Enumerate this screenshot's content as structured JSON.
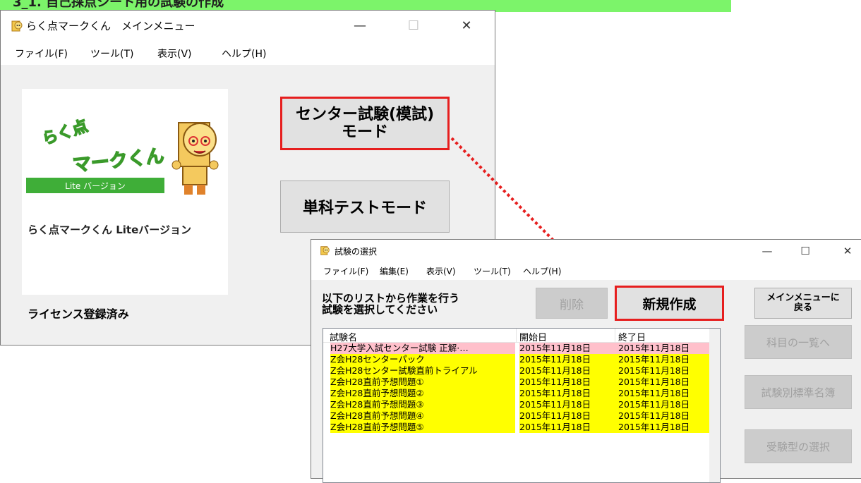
{
  "banner": {
    "text": "3_1. 自己採点シート用の試験の作成"
  },
  "main_window": {
    "title": "らく点マークくん　メインメニュー",
    "menu": [
      "ファイル(F)",
      "ツール(T)",
      "表示(V)",
      "ヘルプ(H)"
    ],
    "logo": {
      "line1": "らく点",
      "line2": "マークくん",
      "badge": "Lite バージョン"
    },
    "logo_caption": "らく点マークくん Liteバージョン",
    "license": "ライセンス登録済み",
    "center_mode_line1": "センター試験(模試)",
    "center_mode_line2": "モード",
    "single_mode": "単科テストモード"
  },
  "exam_window": {
    "title": "試験の選択",
    "menu": [
      "ファイル(F)",
      "編集(E)",
      "表示(V)",
      "ツール(T)",
      "ヘルプ(H)"
    ],
    "instruction_line1": "以下のリストから作業を行う",
    "instruction_line2": "試験を選択してください",
    "delete": "削除",
    "new": "新規作成",
    "back_line1": "メインメニューに",
    "back_line2": "戻る",
    "side_buttons": [
      "科目の一覧へ",
      "試験別標準名簿",
      "受験型の選択"
    ],
    "columns": [
      "試験名",
      "開始日",
      "終了日"
    ],
    "rows": [
      {
        "name": "H27大学入試センター試験 正解·…",
        "start": "2015年11月18日",
        "end": "2015年11月18日",
        "color": "#ffc0cb"
      },
      {
        "name": "Z会H28センターパック",
        "start": "2015年11月18日",
        "end": "2015年11月18日",
        "color": "#ffff00"
      },
      {
        "name": "Z会H28センター試験直前トライアル",
        "start": "2015年11月18日",
        "end": "2015年11月18日",
        "color": "#ffff00"
      },
      {
        "name": "Z会H28直前予想問題①",
        "start": "2015年11月18日",
        "end": "2015年11月18日",
        "color": "#ffff00"
      },
      {
        "name": "Z会H28直前予想問題②",
        "start": "2015年11月18日",
        "end": "2015年11月18日",
        "color": "#ffff00"
      },
      {
        "name": "Z会H28直前予想問題③",
        "start": "2015年11月18日",
        "end": "2015年11月18日",
        "color": "#ffff00"
      },
      {
        "name": "Z会H28直前予想問題④",
        "start": "2015年11月18日",
        "end": "2015年11月18日",
        "color": "#ffff00"
      },
      {
        "name": "Z会H28直前予想問題⑤",
        "start": "2015年11月18日",
        "end": "2015年11月18日",
        "color": "#ffff00"
      }
    ]
  },
  "colors": {
    "highlight": "#e61e1e",
    "banner": "#7cf46a"
  }
}
